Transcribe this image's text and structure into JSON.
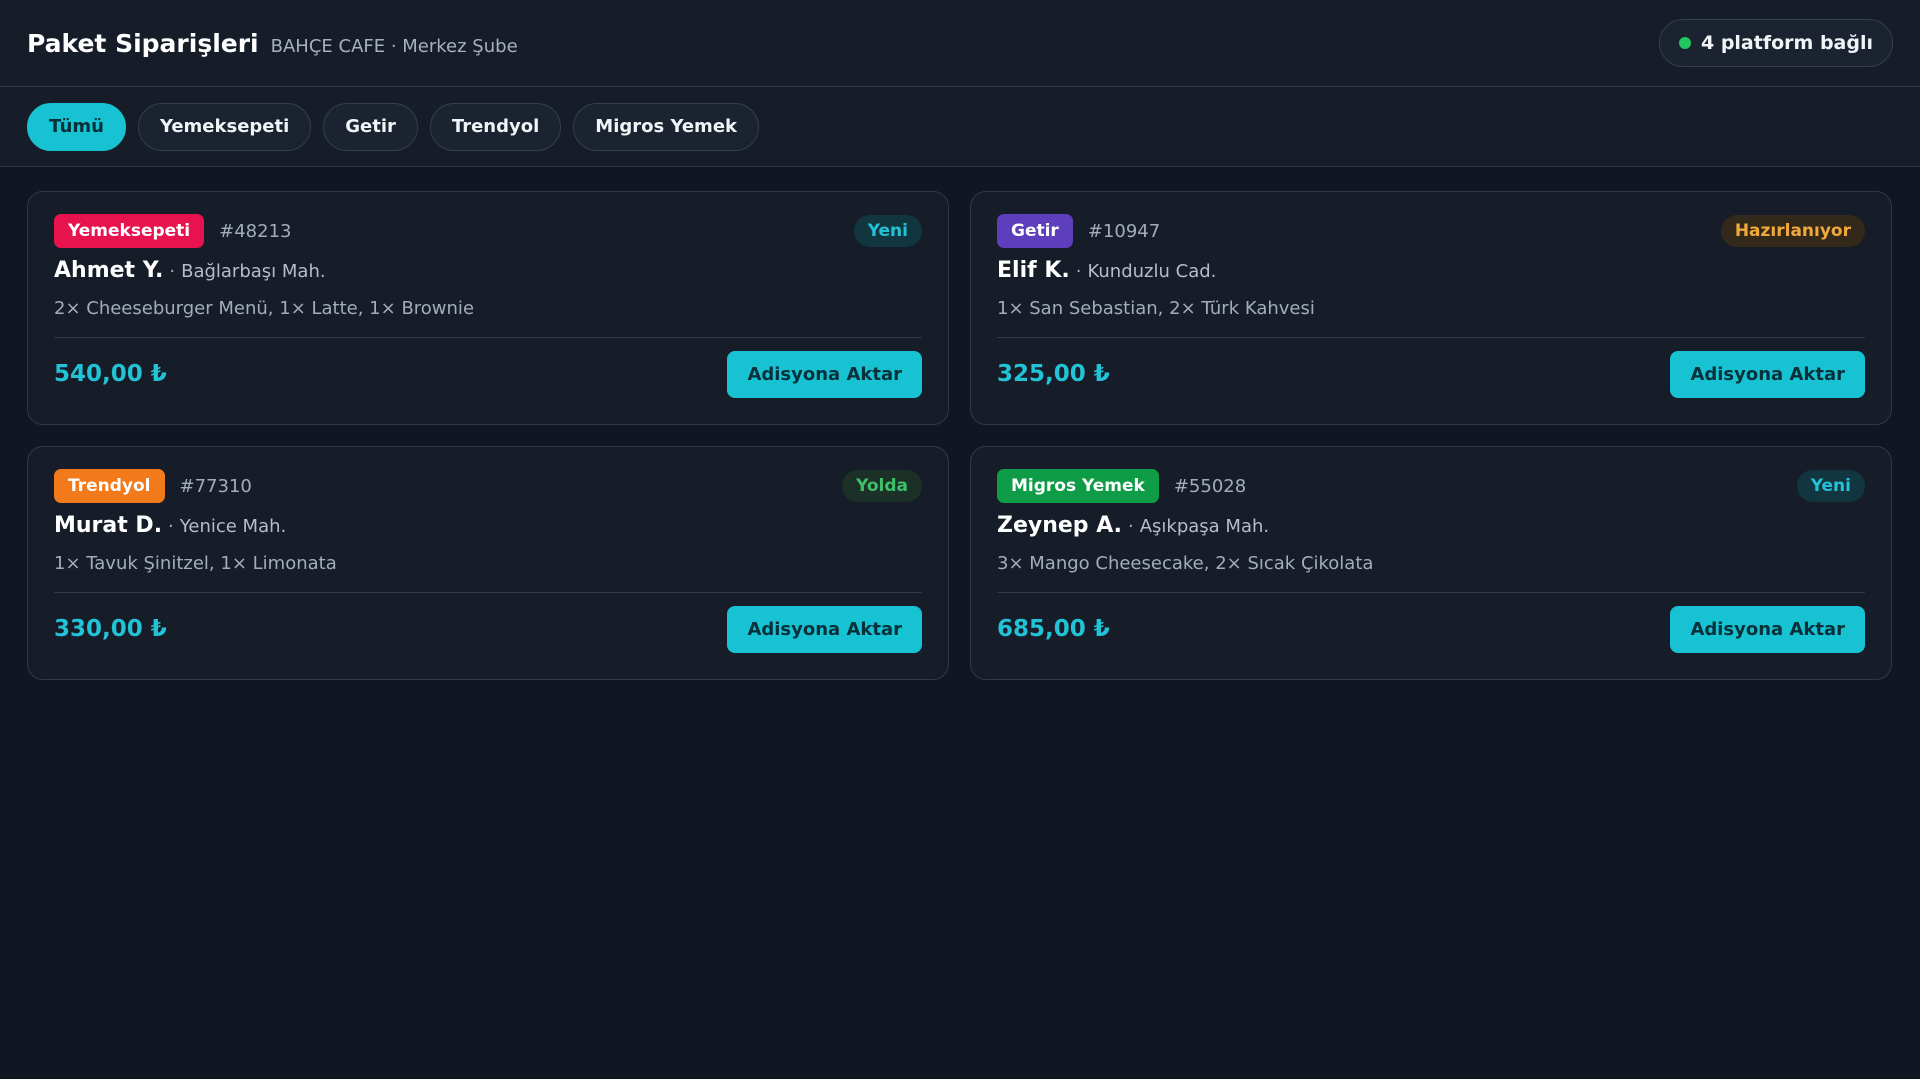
{
  "header": {
    "title": "Paket Siparişleri",
    "subtitle": "BAHÇE CAFE · Merkez Şube",
    "platform_status": "4 platform bağlı",
    "status_color": "#22c55e"
  },
  "tabs": [
    {
      "label": "Tümü",
      "active": true
    },
    {
      "label": "Yemeksepeti",
      "active": false
    },
    {
      "label": "Getir",
      "active": false
    },
    {
      "label": "Trendyol",
      "active": false
    },
    {
      "label": "Migros Yemek",
      "active": false
    }
  ],
  "orders": [
    {
      "platform": "Yemeksepeti",
      "platform_color": "#e8124e",
      "order_id": "#48213",
      "status": "Yeni",
      "status_color": "#22c3d6",
      "status_bg": "#123640",
      "customer": "Ahmet Y.",
      "separator": "·",
      "address": "Bağlarbaşı Mah.",
      "items": "2× Cheeseburger Menü, 1× Latte, 1× Brownie",
      "price": "540,00 ₺",
      "action_label": "Adisyona Aktar"
    },
    {
      "platform": "Getir",
      "platform_color": "#5d3ebc",
      "order_id": "#10947",
      "status": "Hazırlanıyor",
      "status_color": "#f0a93a",
      "status_bg": "#33291a",
      "customer": "Elif K.",
      "separator": "·",
      "address": "Kunduzlu Cad.",
      "items": "1× San Sebastian, 2× Türk Kahvesi",
      "price": "325,00 ₺",
      "action_label": "Adisyona Aktar"
    },
    {
      "platform": "Trendyol",
      "platform_color": "#f27a1a",
      "order_id": "#77310",
      "status": "Yolda",
      "status_color": "#3fbf6a",
      "status_bg": "#1b3127",
      "customer": "Murat D.",
      "separator": "·",
      "address": "Yenice Mah.",
      "items": "1× Tavuk Şinitzel, 1× Limonata",
      "price": "330,00 ₺",
      "action_label": "Adisyona Aktar"
    },
    {
      "platform": "Migros Yemek",
      "platform_color": "#0e9c46",
      "order_id": "#55028",
      "status": "Yeni",
      "status_color": "#22c3d6",
      "status_bg": "#123640",
      "customer": "Zeynep A.",
      "separator": "·",
      "address": "Aşıkpaşa Mah.",
      "items": "3× Mango Cheesecake, 2× Sıcak Çikolata",
      "price": "685,00 ₺",
      "action_label": "Adisyona Aktar"
    }
  ]
}
